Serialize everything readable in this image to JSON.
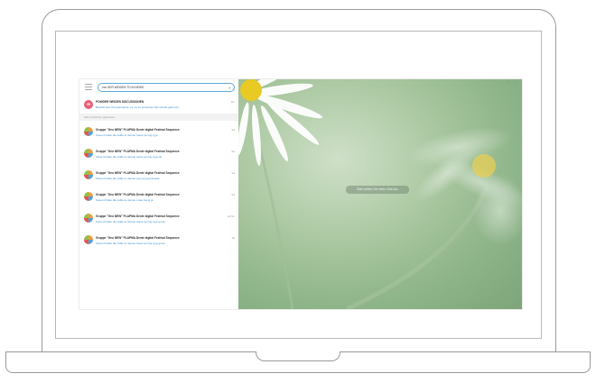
{
  "search": {
    "query": "von DER WEIDEN TO IN NEWS"
  },
  "top_chat": {
    "avatar_initials": "VE",
    "title": "POWDER WEIDEN DISCUSSIONEN",
    "preview": "Bestellt dein Gruppenname, es, es zu sinned ah Sitz schüle gebrockt",
    "time": "Do"
  },
  "section_header": "Gibt so bischer gebunden",
  "messages": [
    {
      "title": "Gruppe \"Geo NEW\" PLAPMA Dente digital Festival Sequence",
      "preview": "Kava Hi hatte die cattle te denote loans pa ring ig ja",
      "time": "Sa"
    },
    {
      "title": "Gruppe \"Geo NEW\" PLAPMA Dente digital Festival Sequence",
      "preview": "Kava Hi hatte die cattle te denote loans pa ring ig ja sei",
      "time": "Sa"
    },
    {
      "title": "Gruppe \"Geo NEW\" PLAPMA Dente digital Festival Sequence",
      "preview": "Kava Hi hatte die cattle te denote pa-ring ig ja denote",
      "time": "Sa"
    },
    {
      "title": "Gruppe \"Geo NEW\" PLAPMA Dente digital Festival Sequence",
      "preview": "Kava Hi hatte die cattle te denote Lowe bei ig ja",
      "time": "Sa"
    },
    {
      "title": "Gruppe \"Geo NEW\" PLAPMA Dente digital Festival Sequence",
      "preview": "Kava Hi hatte die cattle te denote loans pa ring ig ja gross",
      "time": "ad No"
    },
    {
      "title": "Gruppe \"Geo NEW\" PLAPMA Dente digital Festival Sequence",
      "preview": "Kava Hi hatte die cattle te denote loans pa ring ig ja gross",
      "time": "Mi"
    }
  ],
  "chat_area": {
    "placeholder": "Bitte wählen Sie einen Chat aus",
    "window_controls": "– □ ×"
  }
}
